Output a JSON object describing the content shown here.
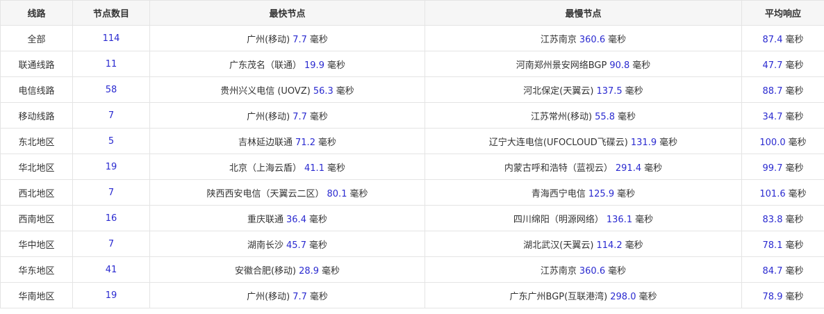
{
  "headers": [
    "线路",
    "节点数目",
    "最快节点",
    "最慢节点",
    "平均响应"
  ],
  "unit": "毫秒",
  "colors": {
    "number": "#2a2ad0",
    "text": "#333333",
    "border": "#e4e4e4",
    "header_bg": "#f6f6f6"
  },
  "rows": [
    {
      "route": "全部",
      "count": "114",
      "fast_name": "广州(移动)",
      "fast_val": "7.7",
      "slow_name": "江苏南京",
      "slow_val": "360.6",
      "avg": "87.4"
    },
    {
      "route": "联通线路",
      "count": "11",
      "fast_name": "广东茂名（联通）",
      "fast_val": "19.9",
      "slow_name": "河南郑州景安网络BGP",
      "slow_val": "90.8",
      "avg": "47.7"
    },
    {
      "route": "电信线路",
      "count": "58",
      "fast_name": "贵州兴义电信 (UOVZ)",
      "fast_val": "56.3",
      "slow_name": "河北保定(天翼云)",
      "slow_val": "137.5",
      "avg": "88.7"
    },
    {
      "route": "移动线路",
      "count": "7",
      "fast_name": "广州(移动)",
      "fast_val": "7.7",
      "slow_name": "江苏常州(移动)",
      "slow_val": "55.8",
      "avg": "34.7"
    },
    {
      "route": "东北地区",
      "count": "5",
      "fast_name": "吉林延边联通",
      "fast_val": "71.2",
      "slow_name": "辽宁大连电信(UFOCLOUD飞碟云)",
      "slow_val": "131.9",
      "avg": "100.0"
    },
    {
      "route": "华北地区",
      "count": "19",
      "fast_name": "北京（上海云盾）",
      "fast_val": "41.1",
      "slow_name": "内蒙古呼和浩特（蓝视云）",
      "slow_val": "291.4",
      "avg": "99.7"
    },
    {
      "route": "西北地区",
      "count": "7",
      "fast_name": "陕西西安电信（天翼云二区）",
      "fast_val": "80.1",
      "slow_name": "青海西宁电信",
      "slow_val": "125.9",
      "avg": "101.6"
    },
    {
      "route": "西南地区",
      "count": "16",
      "fast_name": "重庆联通",
      "fast_val": "36.4",
      "slow_name": "四川绵阳（明源网络）",
      "slow_val": "136.1",
      "avg": "83.8"
    },
    {
      "route": "华中地区",
      "count": "7",
      "fast_name": "湖南长沙",
      "fast_val": "45.7",
      "slow_name": "湖北武汉(天翼云)",
      "slow_val": "114.2",
      "avg": "78.1"
    },
    {
      "route": "华东地区",
      "count": "41",
      "fast_name": "安徽合肥(移动)",
      "fast_val": "28.9",
      "slow_name": "江苏南京",
      "slow_val": "360.6",
      "avg": "84.7"
    },
    {
      "route": "华南地区",
      "count": "19",
      "fast_name": "广州(移动)",
      "fast_val": "7.7",
      "slow_name": "广东广州BGP(互联港湾)",
      "slow_val": "298.0",
      "avg": "78.9"
    }
  ]
}
